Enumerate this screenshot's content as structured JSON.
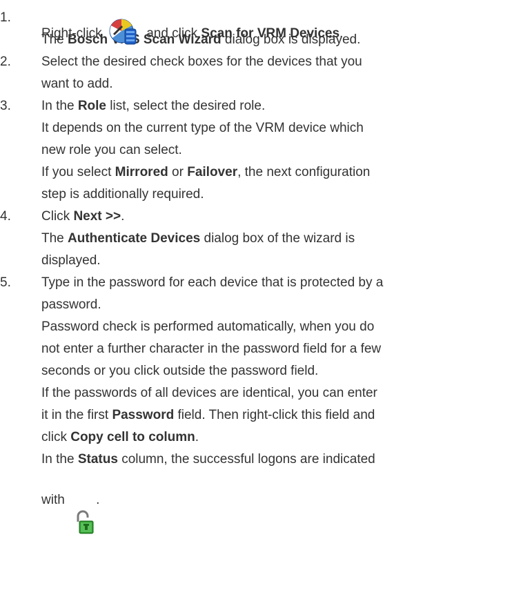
{
  "steps": [
    {
      "number": "1.",
      "lines": {
        "l1_a": "Right-click",
        "l1_b": "and click",
        "l1_bold": "Scan for VRM Devices",
        "l1_end": ".",
        "l2_a": "The",
        "l2_bold": "Bosch VMS Scan Wizard",
        "l2_b": "dialog box is displayed."
      }
    },
    {
      "number": "2.",
      "lines": {
        "l1": "Select the desired check boxes for the devices that you",
        "l2": "want to add."
      }
    },
    {
      "number": "3.",
      "lines": {
        "l1_a": "In the",
        "l1_bold": "Role",
        "l1_b": "list, select the desired role.",
        "l2": "It depends on the current type of the VRM device which",
        "l3": "new role you can select.",
        "l4_a": "If you select",
        "l4_bold1": "Mirrored",
        "l4_or": "or",
        "l4_bold2": "Failover",
        "l4_b": ", the next configuration",
        "l5": "step is additionally required."
      }
    },
    {
      "number": "4.",
      "lines": {
        "l1_a": "Click",
        "l1_bold": "Next >>",
        "l1_end": ".",
        "l2_a": "The",
        "l2_bold": "Authenticate Devices",
        "l2_b": "dialog box of the wizard is",
        "l3": "displayed."
      }
    },
    {
      "number": "5.",
      "lines": {
        "l1": "Type in the password for each device that is protected by a",
        "l2": "password.",
        "l3": "Password check is performed automatically, when you do",
        "l4": "not enter a further character in the password field for a few",
        "l5": "seconds or you click outside the password field.",
        "l6": "If the passwords of all devices are identical, you can enter",
        "l7_a": "it in the first",
        "l7_bold": "Password",
        "l7_b": "field. Then right-click this field and",
        "l8_a": "click",
        "l8_bold": "Copy cell to column",
        "l8_end": ".",
        "l9_a": "In the",
        "l9_bold": "Status",
        "l9_b": "column, the successful logons are indicated",
        "l10_a": "with",
        "l10_end": "."
      }
    }
  ],
  "icons": {
    "vrm": "vrm-device-icon",
    "lock": "unlocked-padlock-icon"
  },
  "colors": {
    "text": "#333333",
    "icon_blue": "#1f5fc4",
    "icon_lock_green": "#2e9a2e"
  }
}
